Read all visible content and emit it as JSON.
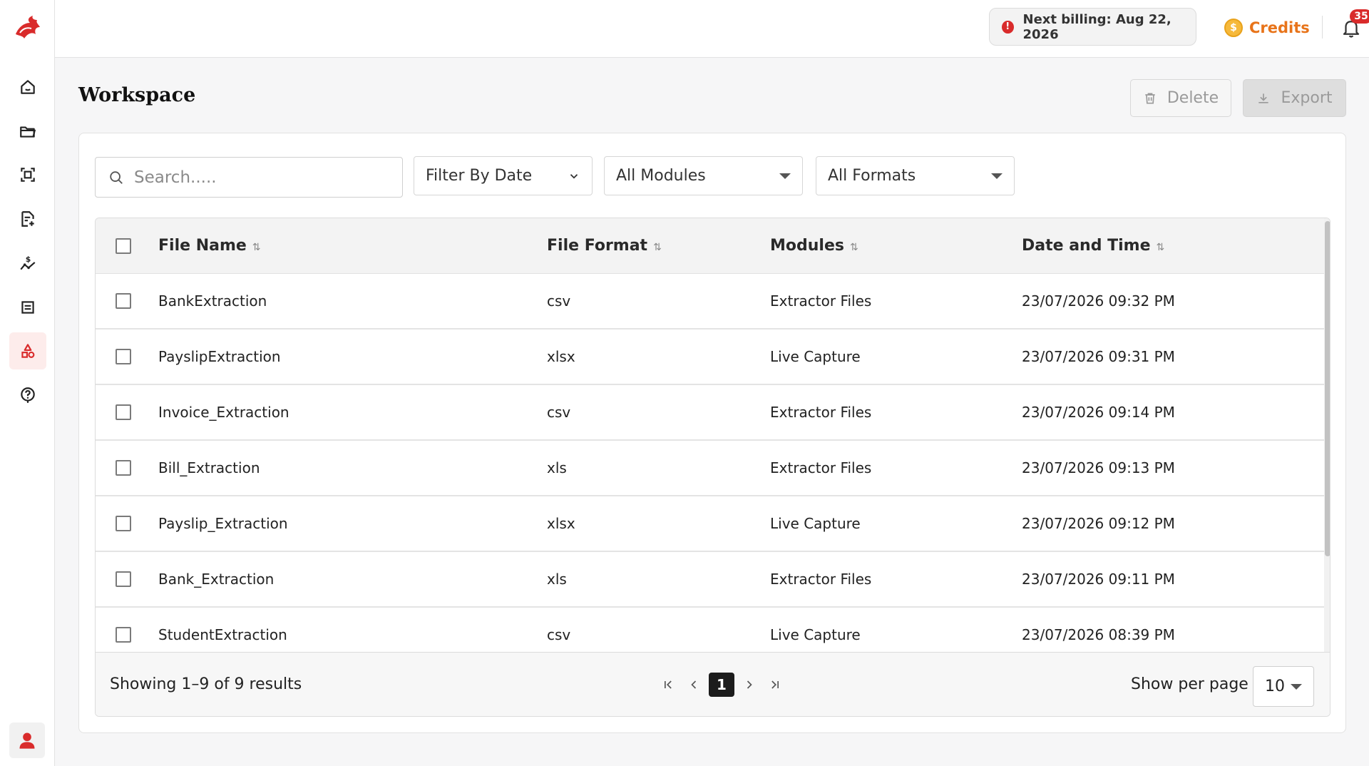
{
  "header": {
    "billing_text": "Next billing: Aug 22, 2026",
    "billing_icon": "info-icon",
    "credits_label": "Credits",
    "credits_icon": "coin-icon",
    "notification_count": "35",
    "accent_color": "#d92b2b",
    "credits_color": "#e8741a"
  },
  "sidebar": {
    "items": [
      {
        "name": "home",
        "icon": "home-icon"
      },
      {
        "name": "folder",
        "icon": "folder-icon"
      },
      {
        "name": "scan",
        "icon": "scan-icon"
      },
      {
        "name": "document-add",
        "icon": "document-add-icon"
      },
      {
        "name": "billing",
        "icon": "dollar-chart-icon"
      },
      {
        "name": "list",
        "icon": "list-icon"
      },
      {
        "name": "workspace",
        "icon": "shapes-icon",
        "active": true
      },
      {
        "name": "help",
        "icon": "help-icon"
      }
    ],
    "user_icon": "user-icon"
  },
  "page": {
    "title": "Workspace",
    "delete_label": "Delete",
    "export_label": "Export"
  },
  "filters": {
    "search_placeholder": "Search.....",
    "date_label": "Filter By Date",
    "modules_label": "All Modules",
    "formats_label": "All Formats"
  },
  "table": {
    "columns": [
      "File Name",
      "File Format",
      "Modules",
      "Date and Time"
    ],
    "rows": [
      {
        "name": "BankExtraction",
        "format": "csv",
        "module": "Extractor Files",
        "date": "23/07/2026 09:32 PM"
      },
      {
        "name": "PayslipExtraction",
        "format": "xlsx",
        "module": "Live Capture",
        "date": "23/07/2026 09:31 PM"
      },
      {
        "name": "Invoice_Extraction",
        "format": "csv",
        "module": "Extractor Files",
        "date": "23/07/2026 09:14 PM"
      },
      {
        "name": "Bill_Extraction",
        "format": "xls",
        "module": "Extractor Files",
        "date": "23/07/2026 09:13 PM"
      },
      {
        "name": "Payslip_Extraction",
        "format": "xlsx",
        "module": "Live Capture",
        "date": "23/07/2026 09:12 PM"
      },
      {
        "name": "Bank_Extraction",
        "format": "xls",
        "module": "Extractor Files",
        "date": "23/07/2026 09:11 PM"
      },
      {
        "name": "StudentExtraction",
        "format": "csv",
        "module": "Live Capture",
        "date": "23/07/2026 08:39 PM"
      }
    ]
  },
  "footer": {
    "showing": "Showing 1–9 of 9 results",
    "current_page": "1",
    "per_page_label": "Show per page",
    "per_page_value": "10"
  }
}
